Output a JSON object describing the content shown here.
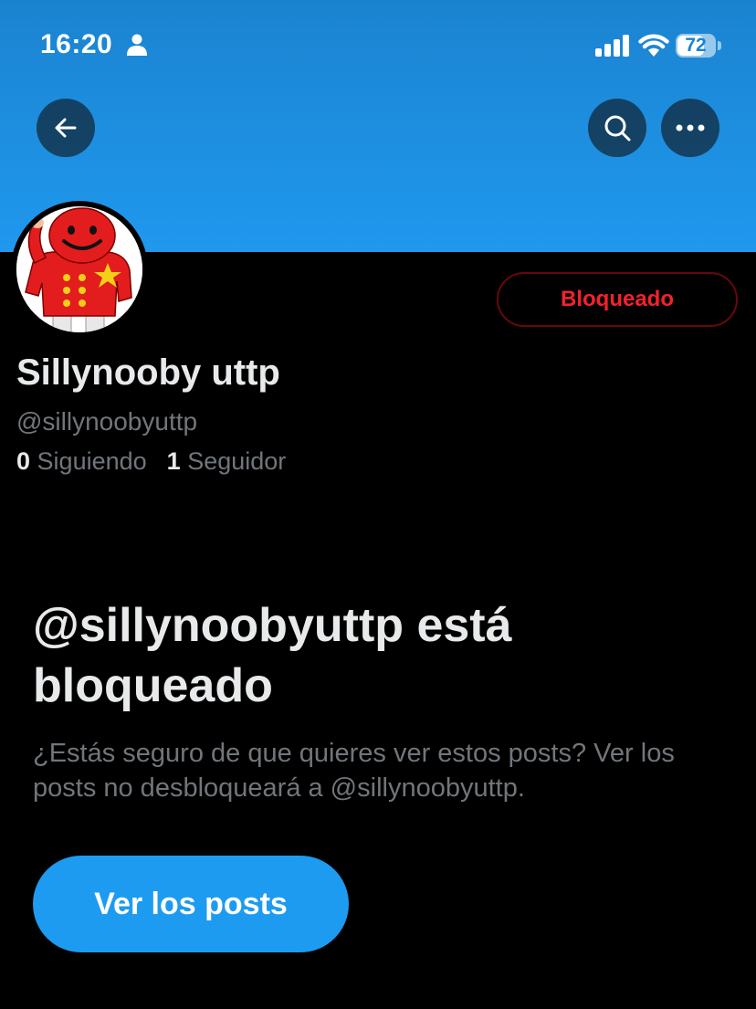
{
  "status_bar": {
    "time": "16:20",
    "battery_percent": "72",
    "battery_level": 0.72
  },
  "header": {
    "back_icon": "arrow-left-icon",
    "search_icon": "search-icon",
    "more_icon": "more-horizontal-icon"
  },
  "profile": {
    "display_name": "Sillynooby uttp",
    "handle": "@sillynoobyuttp",
    "following_count": "0",
    "following_label": "Siguiendo",
    "followers_count": "1",
    "followers_label": "Seguidor",
    "blocked_button_label": "Bloqueado"
  },
  "blocked_notice": {
    "title": "@sillynoobyuttp está bloqueado",
    "description": "¿Estás seguro de que quieres ver estos posts? Ver los posts no desbloqueará a @sillynoobyuttp.",
    "view_posts_label": "Ver los posts"
  },
  "colors": {
    "accent": "#1d9bf0",
    "blocked_red": "#f4212e",
    "banner": "#1f98ee",
    "secondary_text": "#71767b"
  }
}
